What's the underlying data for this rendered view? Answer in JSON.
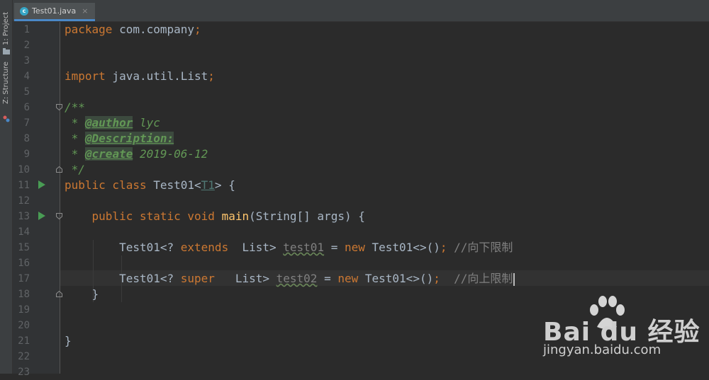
{
  "toolwindows": {
    "project": "1: Project",
    "structure": "Z: Structure"
  },
  "editor_tab": {
    "filename": "Test01.java",
    "icon": "class-c-icon",
    "close": "×"
  },
  "line_numbers": [
    "1",
    "2",
    "3",
    "4",
    "5",
    "6",
    "7",
    "8",
    "9",
    "10",
    "11",
    "12",
    "13",
    "14",
    "15",
    "16",
    "17",
    "18",
    "19",
    "20",
    "21",
    "22",
    "23"
  ],
  "code": {
    "l1": {
      "kw": "package",
      "rest": " com.company",
      "semi": ";"
    },
    "l4": {
      "kw": "import",
      "rest": " java.util.List",
      "semi": ";"
    },
    "l6": "/**",
    "l7": {
      "prefix": " * ",
      "tag": "@author",
      "text": " lyc"
    },
    "l8": {
      "prefix": " * ",
      "tag": "@Description:"
    },
    "l9": {
      "prefix": " * ",
      "tag": "@create",
      "text": " 2019-06-12"
    },
    "l10": " */",
    "l11": {
      "kw": "public class",
      "name": " Test01<",
      "tparam": "T1",
      "rest": "> {"
    },
    "l13": {
      "indent": "    ",
      "kw": "public static void",
      "fn": "main",
      "rest": "(String[] args) {"
    },
    "l15": {
      "indent": "        ",
      "a": "Test01<? ",
      "kw": "extends",
      "b": "  List> ",
      "var": "test01",
      "c": " = ",
      "new": "new",
      "d": " Test01<>()",
      "semi": ";",
      "comment": " //向下限制"
    },
    "l17": {
      "indent": "        ",
      "a": "Test01<? ",
      "kw": "super",
      "b": "   List> ",
      "var": "test02",
      "c": " = ",
      "new": "new",
      "d": " Test01<>()",
      "semi": ";",
      "comment": "  //向上限制"
    },
    "l18": "    }",
    "l21": "}"
  },
  "watermark": {
    "brand": "Bai du 经验",
    "url": "jingyan.baidu.com"
  },
  "colors": {
    "editor_bg": "#2b2b2b",
    "keyword": "#cc7832",
    "function": "#ffc66d",
    "doc_comment": "#629755",
    "line_comment": "#808080",
    "run_marker": "#499c54"
  }
}
